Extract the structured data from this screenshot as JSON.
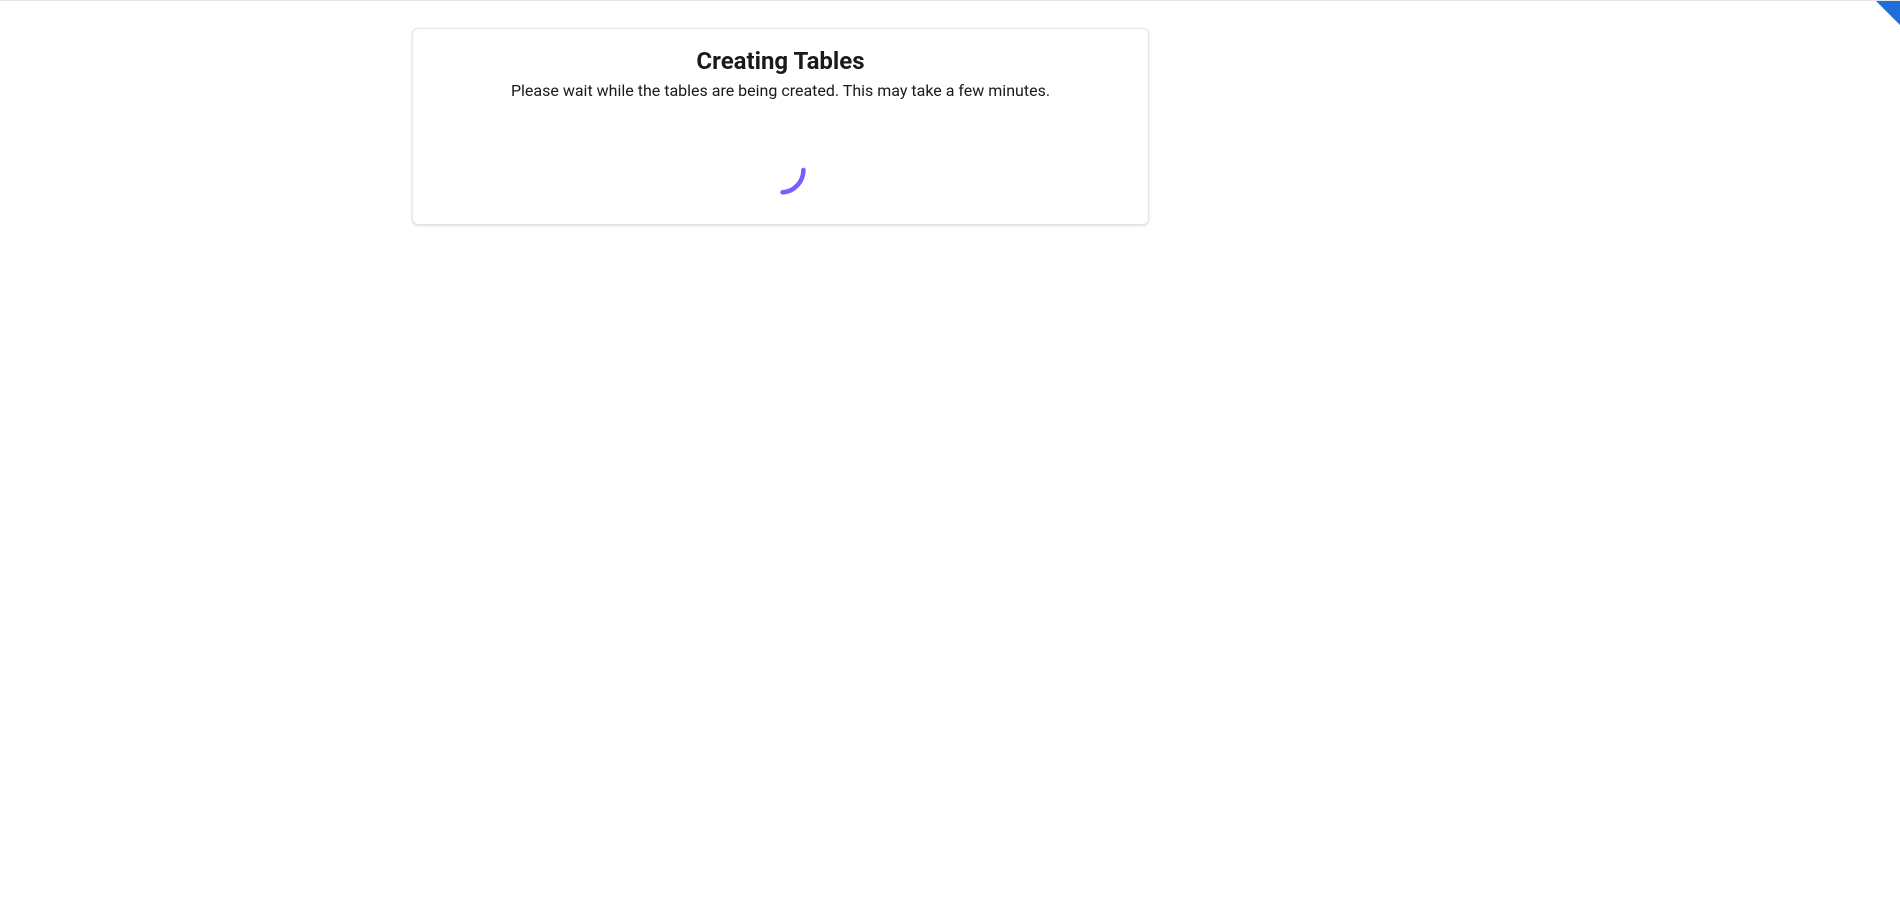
{
  "card": {
    "title": "Creating Tables",
    "subtitle": "Please wait while the tables are being created. This may take a few minutes."
  },
  "spinner": {
    "color": "#7c5cff"
  }
}
